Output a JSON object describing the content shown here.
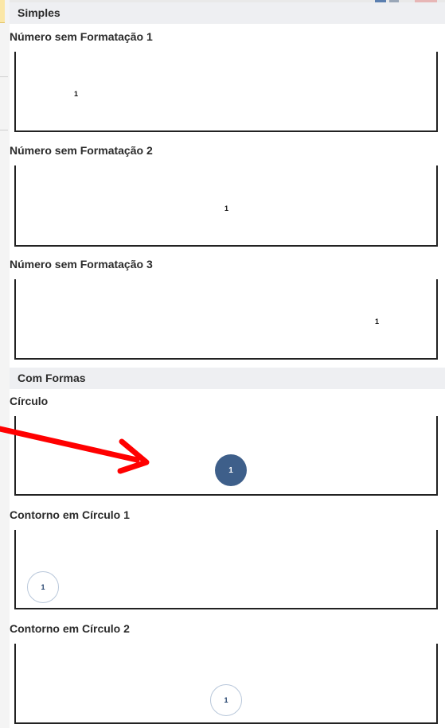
{
  "sections": [
    {
      "header": "Simples",
      "items": [
        {
          "title": "Número sem Formatação 1",
          "number": "1"
        },
        {
          "title": "Número sem Formatação 2",
          "number": "1"
        },
        {
          "title": "Número sem Formatação 3",
          "number": "1"
        }
      ]
    },
    {
      "header": "Com Formas",
      "items": [
        {
          "title": "Círculo",
          "number": "1"
        },
        {
          "title": "Contorno em Círculo 1",
          "number": "1"
        },
        {
          "title": "Contorno em Círculo 2",
          "number": "1"
        }
      ]
    }
  ],
  "colors": {
    "circle_fill": "#3e5f8a",
    "circle_outline": "#b8c7da",
    "annotation_arrow": "#ff0000"
  },
  "annotation": {
    "icon": "red-arrow-icon"
  }
}
